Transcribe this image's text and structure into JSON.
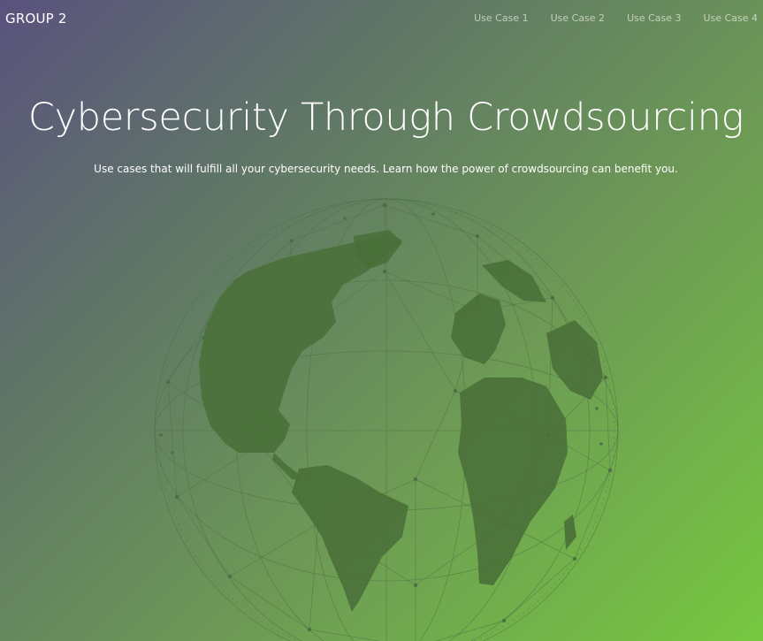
{
  "navbar": {
    "brand": "GROUP 2",
    "links": [
      {
        "label": "Use Case 1"
      },
      {
        "label": "Use Case 2"
      },
      {
        "label": "Use Case 3"
      },
      {
        "label": "Use Case 4"
      }
    ]
  },
  "hero": {
    "title": "Cybersecurity Through Crowdsourcing",
    "subtitle": "Use cases that will fulfill all your cybersecurity needs. Learn how the power of crowdsourcing can benefit you."
  },
  "colors": {
    "gradient_start": "#5a527e",
    "gradient_end": "#77c840",
    "globe_land": "#4a703a",
    "globe_wire": "#4d6f44"
  },
  "icons": {
    "hero_graphic": "network-globe-icon"
  }
}
